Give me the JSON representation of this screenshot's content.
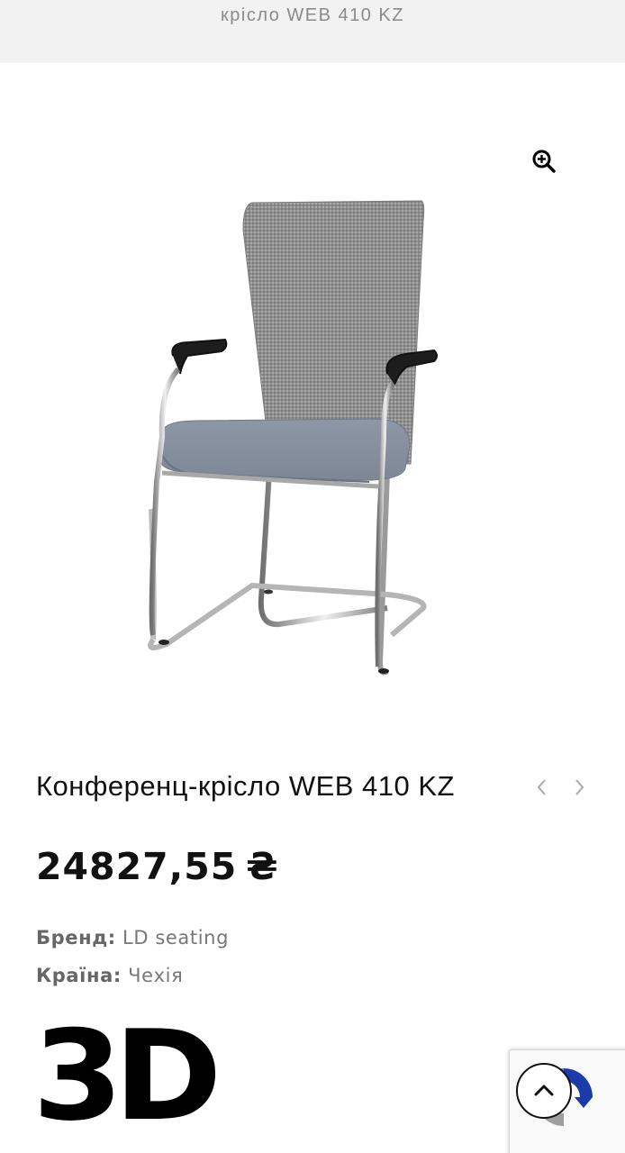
{
  "header": {
    "breadcrumb": "крісло WEB 410 KZ"
  },
  "product": {
    "title": "Конференц-крісло WEB 410 KZ",
    "price": "24827,55",
    "currency": "₴",
    "brand_label": "Бренд:",
    "brand_value": "LD seating",
    "country_label": "Країна:",
    "country_value": "Чехія"
  },
  "logo_text": "3D",
  "icons": {
    "zoom": "zoom-in-icon",
    "prev": "chevron-left-icon",
    "next": "chevron-right-icon",
    "scroll_top": "chevron-up-icon",
    "recaptcha": "recaptcha-icon"
  },
  "colors": {
    "header_bg": "#f2f2f2",
    "text": "#111111",
    "muted": "#777777",
    "recaptcha_blue": "#1c3aa9"
  }
}
